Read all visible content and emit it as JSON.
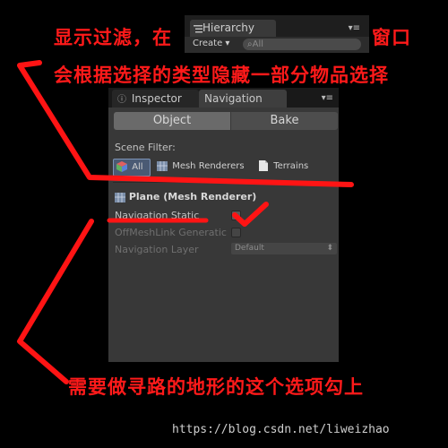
{
  "annotations": {
    "line1_left": "显示过滤，在",
    "line1_right": "窗口",
    "line2": "会根据选择的类型隐藏一部分物品选择",
    "bottom": "需要做寻路的地形的这个选项勾上",
    "color": "#ff1a1a"
  },
  "hierarchy": {
    "tab_label": "Hierarchy",
    "tab_icon": "list-icon",
    "create_label": "Create",
    "search_placeholder": "All"
  },
  "panel": {
    "tabs": [
      {
        "label": "Inspector",
        "icon": "inspector-icon",
        "active": false
      },
      {
        "label": "Navigation",
        "active": true
      }
    ],
    "segments": [
      {
        "label": "Object",
        "selected": true
      },
      {
        "label": "Bake",
        "selected": false
      }
    ],
    "scene_filter_label": "Scene Filter:",
    "filters": [
      {
        "label": "All",
        "icon": "cube-icon",
        "selected": true
      },
      {
        "label": "Mesh Renderers",
        "icon": "mesh-renderer-icon",
        "selected": false
      },
      {
        "label": "Terrains",
        "icon": "terrain-icon",
        "selected": false
      }
    ],
    "object_title": "Plane (Mesh Renderer)",
    "fields": [
      {
        "label": "Navigation Static",
        "type": "checkbox",
        "checked": false
      },
      {
        "label": "OffMeshLink Generatic",
        "type": "checkbox",
        "checked": false,
        "disabled": true
      },
      {
        "label": "Navigation Layer",
        "type": "dropdown",
        "value": "Default",
        "disabled": true
      }
    ]
  },
  "watermark": "https://blog.csdn.net/liweizhao"
}
